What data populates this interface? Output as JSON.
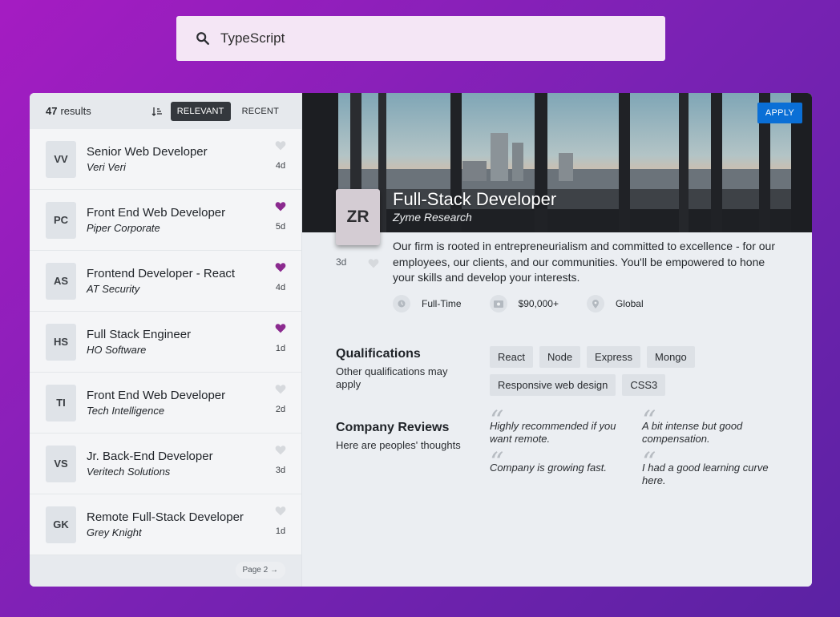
{
  "search": {
    "value": "TypeScript",
    "icon": "search-icon"
  },
  "results": {
    "count": "47",
    "label": "results",
    "sort_icon": "sort-icon",
    "tabs": [
      {
        "label": "RELEVANT",
        "active": true
      },
      {
        "label": "RECENT",
        "active": false
      }
    ]
  },
  "jobs": [
    {
      "initials": "VV",
      "title": "Senior Web Developer",
      "company": "Veri Veri",
      "days": "4d",
      "liked": false
    },
    {
      "initials": "PC",
      "title": "Front End Web Developer",
      "company": "Piper Corporate",
      "days": "5d",
      "liked": true
    },
    {
      "initials": "AS",
      "title": "Frontend Developer - React",
      "company": "AT Security",
      "days": "4d",
      "liked": true
    },
    {
      "initials": "HS",
      "title": "Full Stack Engineer",
      "company": "HO Software",
      "days": "1d",
      "liked": true
    },
    {
      "initials": "TI",
      "title": "Front End Web Developer",
      "company": "Tech Intelligence",
      "days": "2d",
      "liked": false
    },
    {
      "initials": "VS",
      "title": "Jr. Back-End Developer",
      "company": "Veritech Solutions",
      "days": "3d",
      "liked": false
    },
    {
      "initials": "GK",
      "title": "Remote Full-Stack Developer",
      "company": "Grey Knight",
      "days": "1d",
      "liked": false
    }
  ],
  "pagination": {
    "label": "Page 2 →"
  },
  "detail": {
    "apply_label": "APPLY",
    "initials": "ZR",
    "title": "Full-Stack Developer",
    "company": "Zyme Research",
    "days": "3d",
    "description": "Our firm is rooted in entrepreneurialism and committed to excellence - for our employees, our clients, and our communities. You'll be empowered to hone your skills and develop your interests.",
    "facts": [
      {
        "icon": "clock-icon",
        "label": "Full-Time"
      },
      {
        "icon": "money-icon",
        "label": "$90,000+"
      },
      {
        "icon": "location-icon",
        "label": "Global"
      }
    ],
    "qualifications": {
      "title": "Qualifications",
      "subtitle": "Other qualifications may apply",
      "tags": [
        "React",
        "Node",
        "Express",
        "Mongo",
        "Responsive web design",
        "CSS3"
      ]
    },
    "reviews": {
      "title": "Company Reviews",
      "subtitle": "Here are peoples' thoughts",
      "quotes": [
        "Highly recommended if you want remote.",
        "A bit intense but good compensation.",
        "Company is growing fast.",
        "I had a good learning curve here."
      ]
    }
  },
  "colors": {
    "accent": "#0a6fd6",
    "heart_liked": "#8b2a8f",
    "heart_unliked": "#d6d9dd",
    "active_tab": "#34383d"
  }
}
